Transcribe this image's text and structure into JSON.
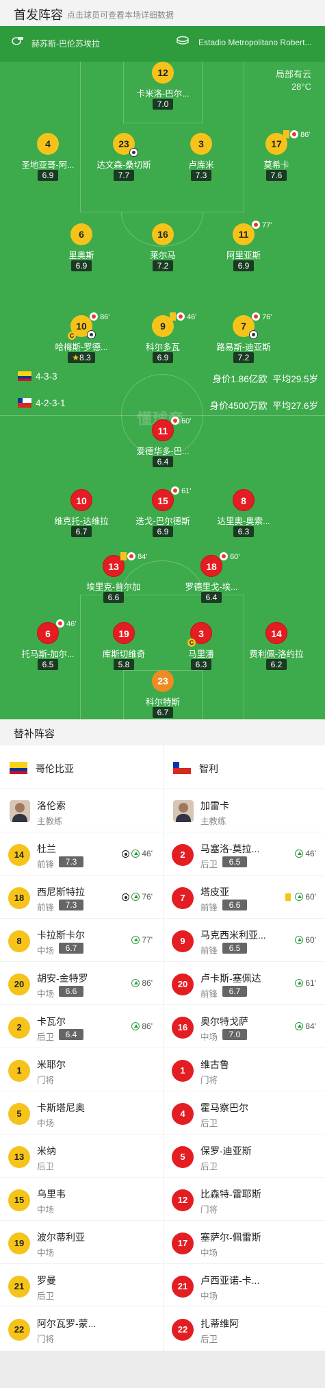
{
  "header": {
    "title": "首发阵容",
    "subtitle": "点击球员可查看本场详细数据"
  },
  "venue": {
    "referee": "赫苏斯-巴伦苏埃拉",
    "stadium": "Estadio Metropolitano Robert...",
    "weather": "局部有云",
    "temperature": "28°C"
  },
  "watermark": "懂球帝",
  "home_team": {
    "name": "哥伦比亚",
    "formation": "4-3-3",
    "value": "身价1.86亿欧",
    "avg_age": "平均29.5岁",
    "players": [
      {
        "number": "12",
        "name": "卡米洛-巴尔...",
        "rating": "7.0"
      },
      {
        "number": "4",
        "name": "圣地亚哥-阿...",
        "rating": "6.9"
      },
      {
        "number": "23",
        "name": "达文森-桑切斯",
        "rating": "7.7"
      },
      {
        "number": "3",
        "name": "卢库米",
        "rating": "7.3"
      },
      {
        "number": "17",
        "name": "莫希卡",
        "rating": "7.6",
        "event": "86'"
      },
      {
        "number": "6",
        "name": "里奥斯",
        "rating": "6.9"
      },
      {
        "number": "16",
        "name": "莱尔马",
        "rating": "7.2"
      },
      {
        "number": "11",
        "name": "阿里亚斯",
        "rating": "6.9",
        "event": "77'"
      },
      {
        "number": "10",
        "name": "哈梅斯-罗德...",
        "rating": "8.3",
        "event": "86'"
      },
      {
        "number": "9",
        "name": "科尔多瓦",
        "rating": "6.9",
        "event": "46'"
      },
      {
        "number": "7",
        "name": "路易斯-迪亚斯",
        "rating": "7.2",
        "event": "76'"
      }
    ]
  },
  "away_team": {
    "name": "智利",
    "formation": "4-2-3-1",
    "value": "身价4500万欧",
    "avg_age": "平均27.6岁",
    "players": [
      {
        "number": "11",
        "name": "爱德华多-巴...",
        "rating": "6.4",
        "event": "60'"
      },
      {
        "number": "10",
        "name": "维克托-达维拉",
        "rating": "6.7"
      },
      {
        "number": "15",
        "name": "迭戈-巴尔德斯",
        "rating": "6.9",
        "event": "61'"
      },
      {
        "number": "8",
        "name": "达里奥-奥索...",
        "rating": "6.3"
      },
      {
        "number": "13",
        "name": "埃里克-普尔加",
        "rating": "6.6",
        "event": "84'"
      },
      {
        "number": "18",
        "name": "罗德里戈-埃...",
        "rating": "6.4",
        "event": "60'"
      },
      {
        "number": "6",
        "name": "托马斯-加尔...",
        "rating": "6.5",
        "event": "46'"
      },
      {
        "number": "19",
        "name": "库斯切维奇",
        "rating": "5.8"
      },
      {
        "number": "3",
        "name": "马里潘",
        "rating": "6.3"
      },
      {
        "number": "14",
        "name": "费利佩-洛约拉",
        "rating": "6.2"
      },
      {
        "number": "23",
        "name": "科尔特斯",
        "rating": "6.7"
      }
    ]
  },
  "subs": {
    "title": "替补阵容",
    "home": {
      "coach": {
        "name": "洛伦索",
        "role": "主教练"
      },
      "players": [
        {
          "number": "14",
          "name": "杜兰",
          "position": "前锋",
          "rating": "7.3",
          "event": "46'"
        },
        {
          "number": "18",
          "name": "西尼斯特拉",
          "position": "前锋",
          "rating": "7.3",
          "event": "76'"
        },
        {
          "number": "8",
          "name": "卡拉斯卡尔",
          "position": "中场",
          "rating": "6.7",
          "event": "77'"
        },
        {
          "number": "20",
          "name": "胡安-金特罗",
          "position": "中场",
          "rating": "6.6",
          "event": "86'"
        },
        {
          "number": "2",
          "name": "卡瓦尔",
          "position": "后卫",
          "rating": "6.4",
          "event": "86'"
        },
        {
          "number": "1",
          "name": "米耶尔",
          "position": "门将"
        },
        {
          "number": "5",
          "name": "卡斯塔尼奥",
          "position": "中场"
        },
        {
          "number": "13",
          "name": "米纳",
          "position": "后卫"
        },
        {
          "number": "15",
          "name": "乌里韦",
          "position": "中场"
        },
        {
          "number": "19",
          "name": "波尔蒂利亚",
          "position": "中场"
        },
        {
          "number": "21",
          "name": "罗曼",
          "position": "后卫"
        },
        {
          "number": "22",
          "name": "阿尔瓦罗-蒙...",
          "position": "门将"
        }
      ]
    },
    "away": {
      "coach": {
        "name": "加雷卡",
        "role": "主教练"
      },
      "players": [
        {
          "number": "2",
          "name": "马塞洛-莫拉...",
          "position": "后卫",
          "rating": "6.5",
          "event": "46'"
        },
        {
          "number": "7",
          "name": "塔皮亚",
          "position": "前锋",
          "rating": "6.6",
          "event": "60'"
        },
        {
          "number": "9",
          "name": "马克西米利亚...",
          "position": "前锋",
          "rating": "6.5",
          "event": "60'"
        },
        {
          "number": "20",
          "name": "卢卡斯-塞佩达",
          "position": "前锋",
          "rating": "6.7",
          "event": "61'"
        },
        {
          "number": "16",
          "name": "奥尔特戈萨",
          "position": "中场",
          "rating": "7.0",
          "event": "84'"
        },
        {
          "number": "1",
          "name": "维古鲁",
          "position": "门将"
        },
        {
          "number": "4",
          "name": "霍马察巴尔",
          "position": "后卫"
        },
        {
          "number": "5",
          "name": "保罗-迪亚斯",
          "position": "后卫"
        },
        {
          "number": "12",
          "name": "比森特-雷耶斯",
          "position": "门将"
        },
        {
          "number": "17",
          "name": "塞萨尔-佩雷斯",
          "position": "中场"
        },
        {
          "number": "21",
          "name": "卢西亚诺-卡...",
          "position": "中场"
        },
        {
          "number": "22",
          "name": "扎蒂维阿",
          "position": "后卫"
        }
      ]
    }
  },
  "colors": {
    "pitch": "#3daa4b",
    "home": "#f6c31a",
    "away": "#e41d22",
    "gk_away": "#f08b22"
  }
}
